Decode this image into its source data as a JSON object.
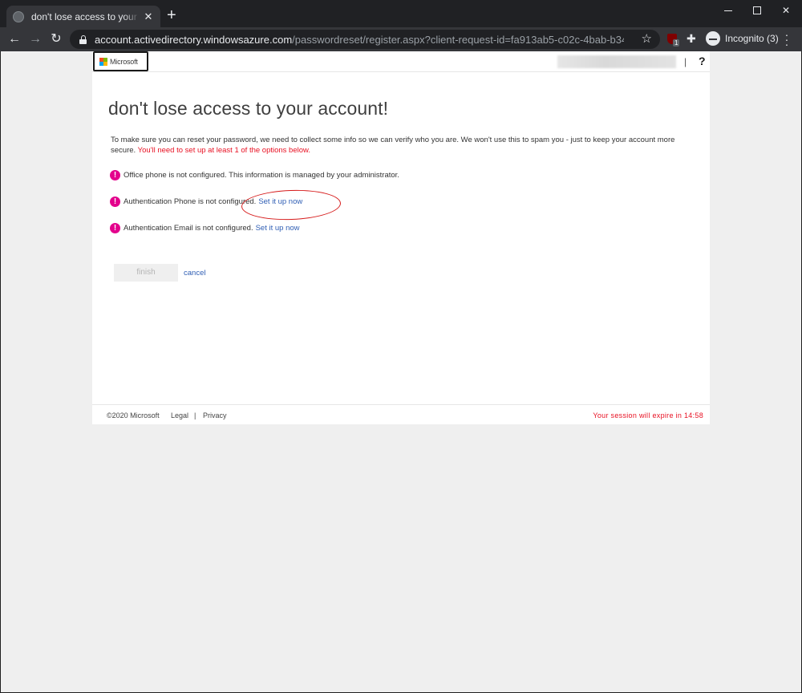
{
  "browser": {
    "tab_title": "don't lose access to your account!",
    "url_host": "account.activedirectory.windowsazure.com",
    "url_path": "/passwordreset/register.aspx?client-request-id=fa913ab5-c02c-4bab-b344-ee482b107721...",
    "incognito_label": "Incognito (3)",
    "extension_badge": "1"
  },
  "header": {
    "logo_text": "Microsoft",
    "separator": "|",
    "help": "?"
  },
  "main": {
    "title": "don't lose access to your account!",
    "intro": "To make sure you can reset your password, we need to collect some info so we can verify who you are. We won't use this to spam you - just to keep your account more secure.",
    "intro_required": "You'll need to set up at least 1 of the options below.",
    "items": [
      {
        "text": "Office phone is not configured. This information is managed by your administrator."
      },
      {
        "text": "Authentication Phone is not configured.",
        "link": "Set it up now"
      },
      {
        "text": "Authentication Email is not configured.",
        "link": "Set it up now"
      }
    ],
    "finish_label": "finish",
    "cancel_label": "cancel"
  },
  "footer": {
    "copyright": "©2020 Microsoft",
    "legal": "Legal",
    "separator": "|",
    "privacy": "Privacy",
    "session": "Your session will expire in 14:58"
  },
  "colors": {
    "alert_icon": "#e3008c",
    "link": "#2f5eb4",
    "required_text": "#e81123",
    "annotation_circle": "#d61a1a"
  }
}
